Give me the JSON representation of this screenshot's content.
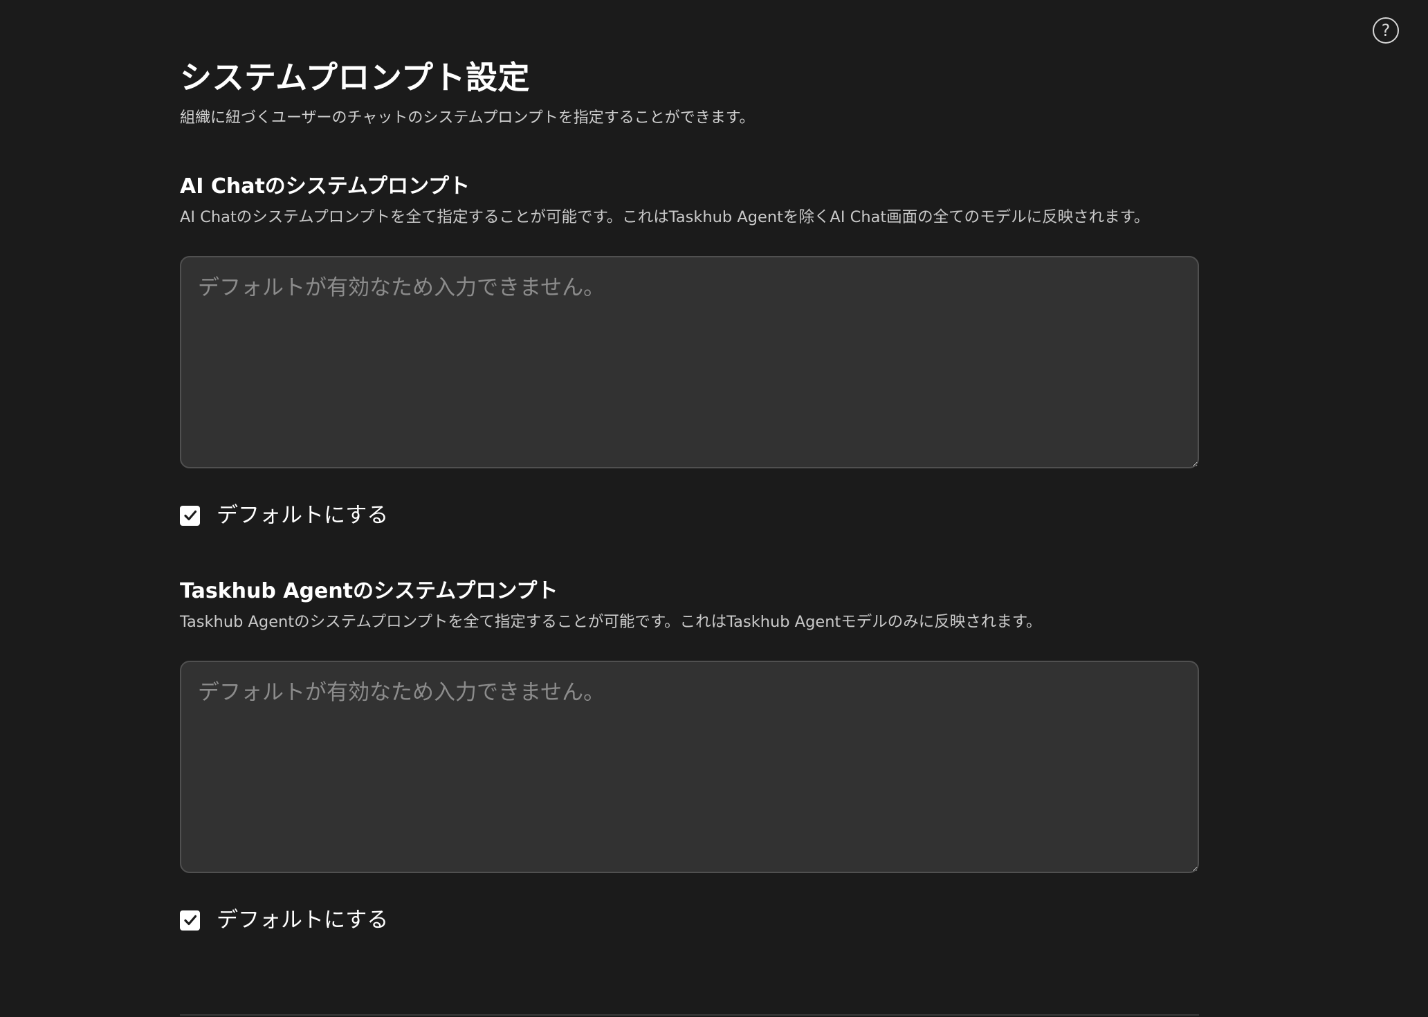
{
  "header": {
    "help_icon": "help-circle-icon",
    "help_glyph": "?"
  },
  "page": {
    "title": "システムプロンプト設定",
    "subtitle": "組織に紐づくユーザーのチャットのシステムプロンプトを指定することができます。"
  },
  "sections": [
    {
      "title": "AI Chatのシステムプロンプト",
      "description": "AI Chatのシステムプロンプトを全て指定することが可能です。これはTaskhub Agentを除くAI Chat画面の全てのモデルに反映されます。",
      "textarea_value": "",
      "textarea_placeholder": "デフォルトが有効なため入力できません。",
      "default_checkbox_label": "デフォルトにする",
      "default_checked": true
    },
    {
      "title": "Taskhub Agentのシステムプロンプト",
      "description": "Taskhub Agentのシステムプロンプトを全て指定することが可能です。これはTaskhub Agentモデルのみに反映されます。",
      "textarea_value": "",
      "textarea_placeholder": "デフォルトが有効なため入力できません。",
      "default_checkbox_label": "デフォルトにする",
      "default_checked": true
    }
  ],
  "colors": {
    "background": "#1b1b1b",
    "textarea_background": "#323232",
    "textarea_border": "#505050",
    "placeholder": "#8c8c8c",
    "checkbox_fill": "#ffffff"
  }
}
